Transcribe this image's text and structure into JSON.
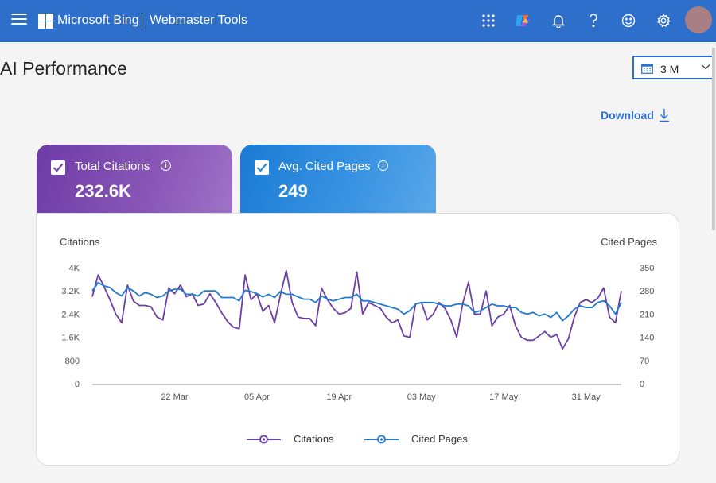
{
  "topbar": {
    "brand": "Microsoft Bing",
    "product": "Webmaster Tools",
    "icons": [
      "menu-icon",
      "apps-grid-icon",
      "copilot-icon",
      "bell-icon",
      "help-icon",
      "smiley-icon",
      "gear-icon"
    ]
  },
  "page": {
    "title": "AI Performance",
    "date_range": "3 M",
    "download_label": "Download"
  },
  "cards": [
    {
      "label": "Total Citations",
      "value": "232.6K",
      "checked": true,
      "color": "#7a48b0"
    },
    {
      "label": "Avg. Cited Pages",
      "value": "249",
      "checked": true,
      "color": "#2a88dc"
    }
  ],
  "chart_data": {
    "type": "line",
    "left_axis_title": "Citations",
    "right_axis_title": "Cited Pages",
    "left_ticks": [
      "4K",
      "3.2K",
      "2.4K",
      "1.6K",
      "800",
      "0"
    ],
    "right_ticks": [
      "350",
      "280",
      "210",
      "140",
      "70",
      "0"
    ],
    "left_ylim": [
      0,
      4000
    ],
    "right_ylim": [
      0,
      350
    ],
    "x_tick_labels": [
      "22 Mar",
      "05 Apr",
      "19 Apr",
      "03 May",
      "17 May",
      "31 May"
    ],
    "x_tick_day_index": [
      14,
      28,
      42,
      56,
      70,
      84
    ],
    "days": 91,
    "series": [
      {
        "name": "Citations",
        "axis": "left",
        "color": "#6c3fa6",
        "values": [
          3000,
          3750,
          3350,
          2900,
          2400,
          2100,
          3400,
          2850,
          2700,
          2700,
          2650,
          2300,
          2200,
          3300,
          3100,
          3400,
          3000,
          3100,
          2700,
          2750,
          3100,
          2800,
          2450,
          2150,
          1950,
          1900,
          3750,
          2900,
          3100,
          2500,
          2700,
          2100,
          3050,
          3900,
          2800,
          2300,
          2250,
          2250,
          2000,
          3300,
          2900,
          2600,
          2400,
          2450,
          2600,
          3850,
          2400,
          2800,
          2700,
          2600,
          2300,
          2100,
          2200,
          1650,
          1600,
          2750,
          2800,
          2200,
          2400,
          2800,
          2600,
          2200,
          1600,
          2750,
          3500,
          2400,
          2400,
          3200,
          2000,
          2300,
          2400,
          2700,
          2000,
          1600,
          1500,
          1500,
          1650,
          1800,
          1600,
          1700,
          1200,
          1550,
          2300,
          2800,
          2900,
          2800,
          2950,
          3300,
          2300,
          2100,
          3200
        ],
        "display": "line"
      },
      {
        "name": "Cited Pages",
        "axis": "right",
        "color": "#1f7ad0",
        "values": [
          280,
          305,
          295,
          290,
          275,
          265,
          290,
          280,
          265,
          275,
          270,
          260,
          265,
          280,
          285,
          285,
          270,
          270,
          265,
          280,
          280,
          280,
          260,
          260,
          260,
          250,
          282,
          278,
          272,
          262,
          270,
          260,
          278,
          270,
          270,
          262,
          255,
          255,
          245,
          265,
          255,
          250,
          255,
          260,
          260,
          270,
          250,
          250,
          245,
          240,
          235,
          230,
          225,
          210,
          220,
          240,
          245,
          245,
          245,
          240,
          235,
          235,
          240,
          240,
          235,
          215,
          220,
          230,
          240,
          235,
          235,
          230,
          230,
          215,
          210,
          215,
          205,
          210,
          200,
          215,
          190,
          205,
          225,
          235,
          230,
          230,
          245,
          250,
          235,
          210,
          245
        ],
        "display": "line"
      }
    ]
  },
  "legend": [
    {
      "label": "Citations",
      "color": "#6c3fa6"
    },
    {
      "label": "Cited Pages",
      "color": "#1f7ad0"
    }
  ]
}
